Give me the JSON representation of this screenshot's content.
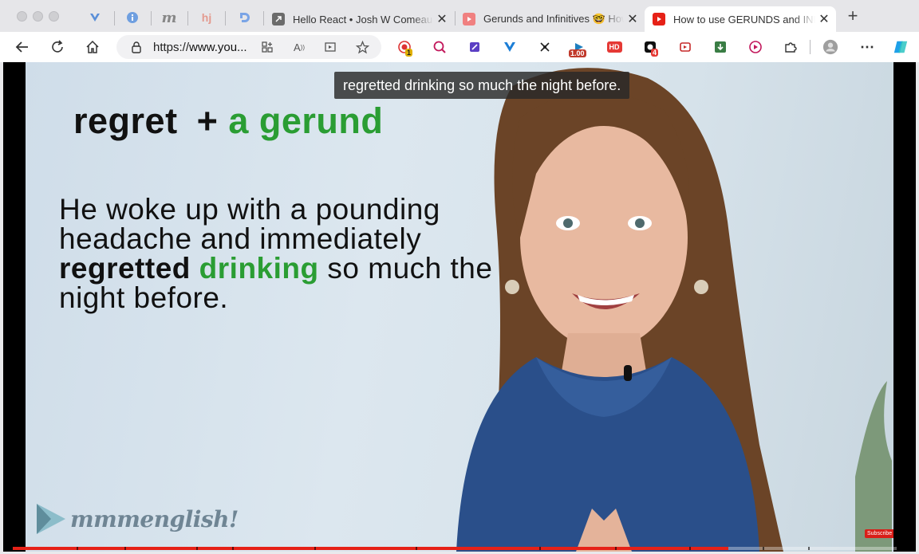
{
  "tabs": [
    {
      "title": "Hello React • Josh W Comeau",
      "active": false
    },
    {
      "title": "Gerunds and Infinitives 🤓 How",
      "active": false
    },
    {
      "title": "How to use GERUNDS and INFINITIVES",
      "active": true
    }
  ],
  "pinned_tabs": [
    "vercel-icon",
    "info-icon",
    "m-icon",
    "hj-icon",
    "d-icon"
  ],
  "toolbar": {
    "url_prefix": "https://",
    "url_host": "www.you...",
    "badges": {
      "ext1": "1",
      "speed": "1.00",
      "hd": "HD",
      "ext_count": "4"
    }
  },
  "video": {
    "caption": "regretted drinking so much the night before.",
    "slide": {
      "word1": "regret",
      "plus": "+",
      "word2": "a gerund",
      "sentence_part1": "He woke up with a pounding headache and immediately ",
      "sentence_strong": "regretted",
      "sentence_green": "drinking",
      "sentence_part2": " so much the night before."
    },
    "logo": "mmmenglish!",
    "subscribe": "Subscribe",
    "progress_fraction": 0.81
  },
  "colors": {
    "green": "#2a9d33",
    "youtube_red": "#e62117"
  }
}
